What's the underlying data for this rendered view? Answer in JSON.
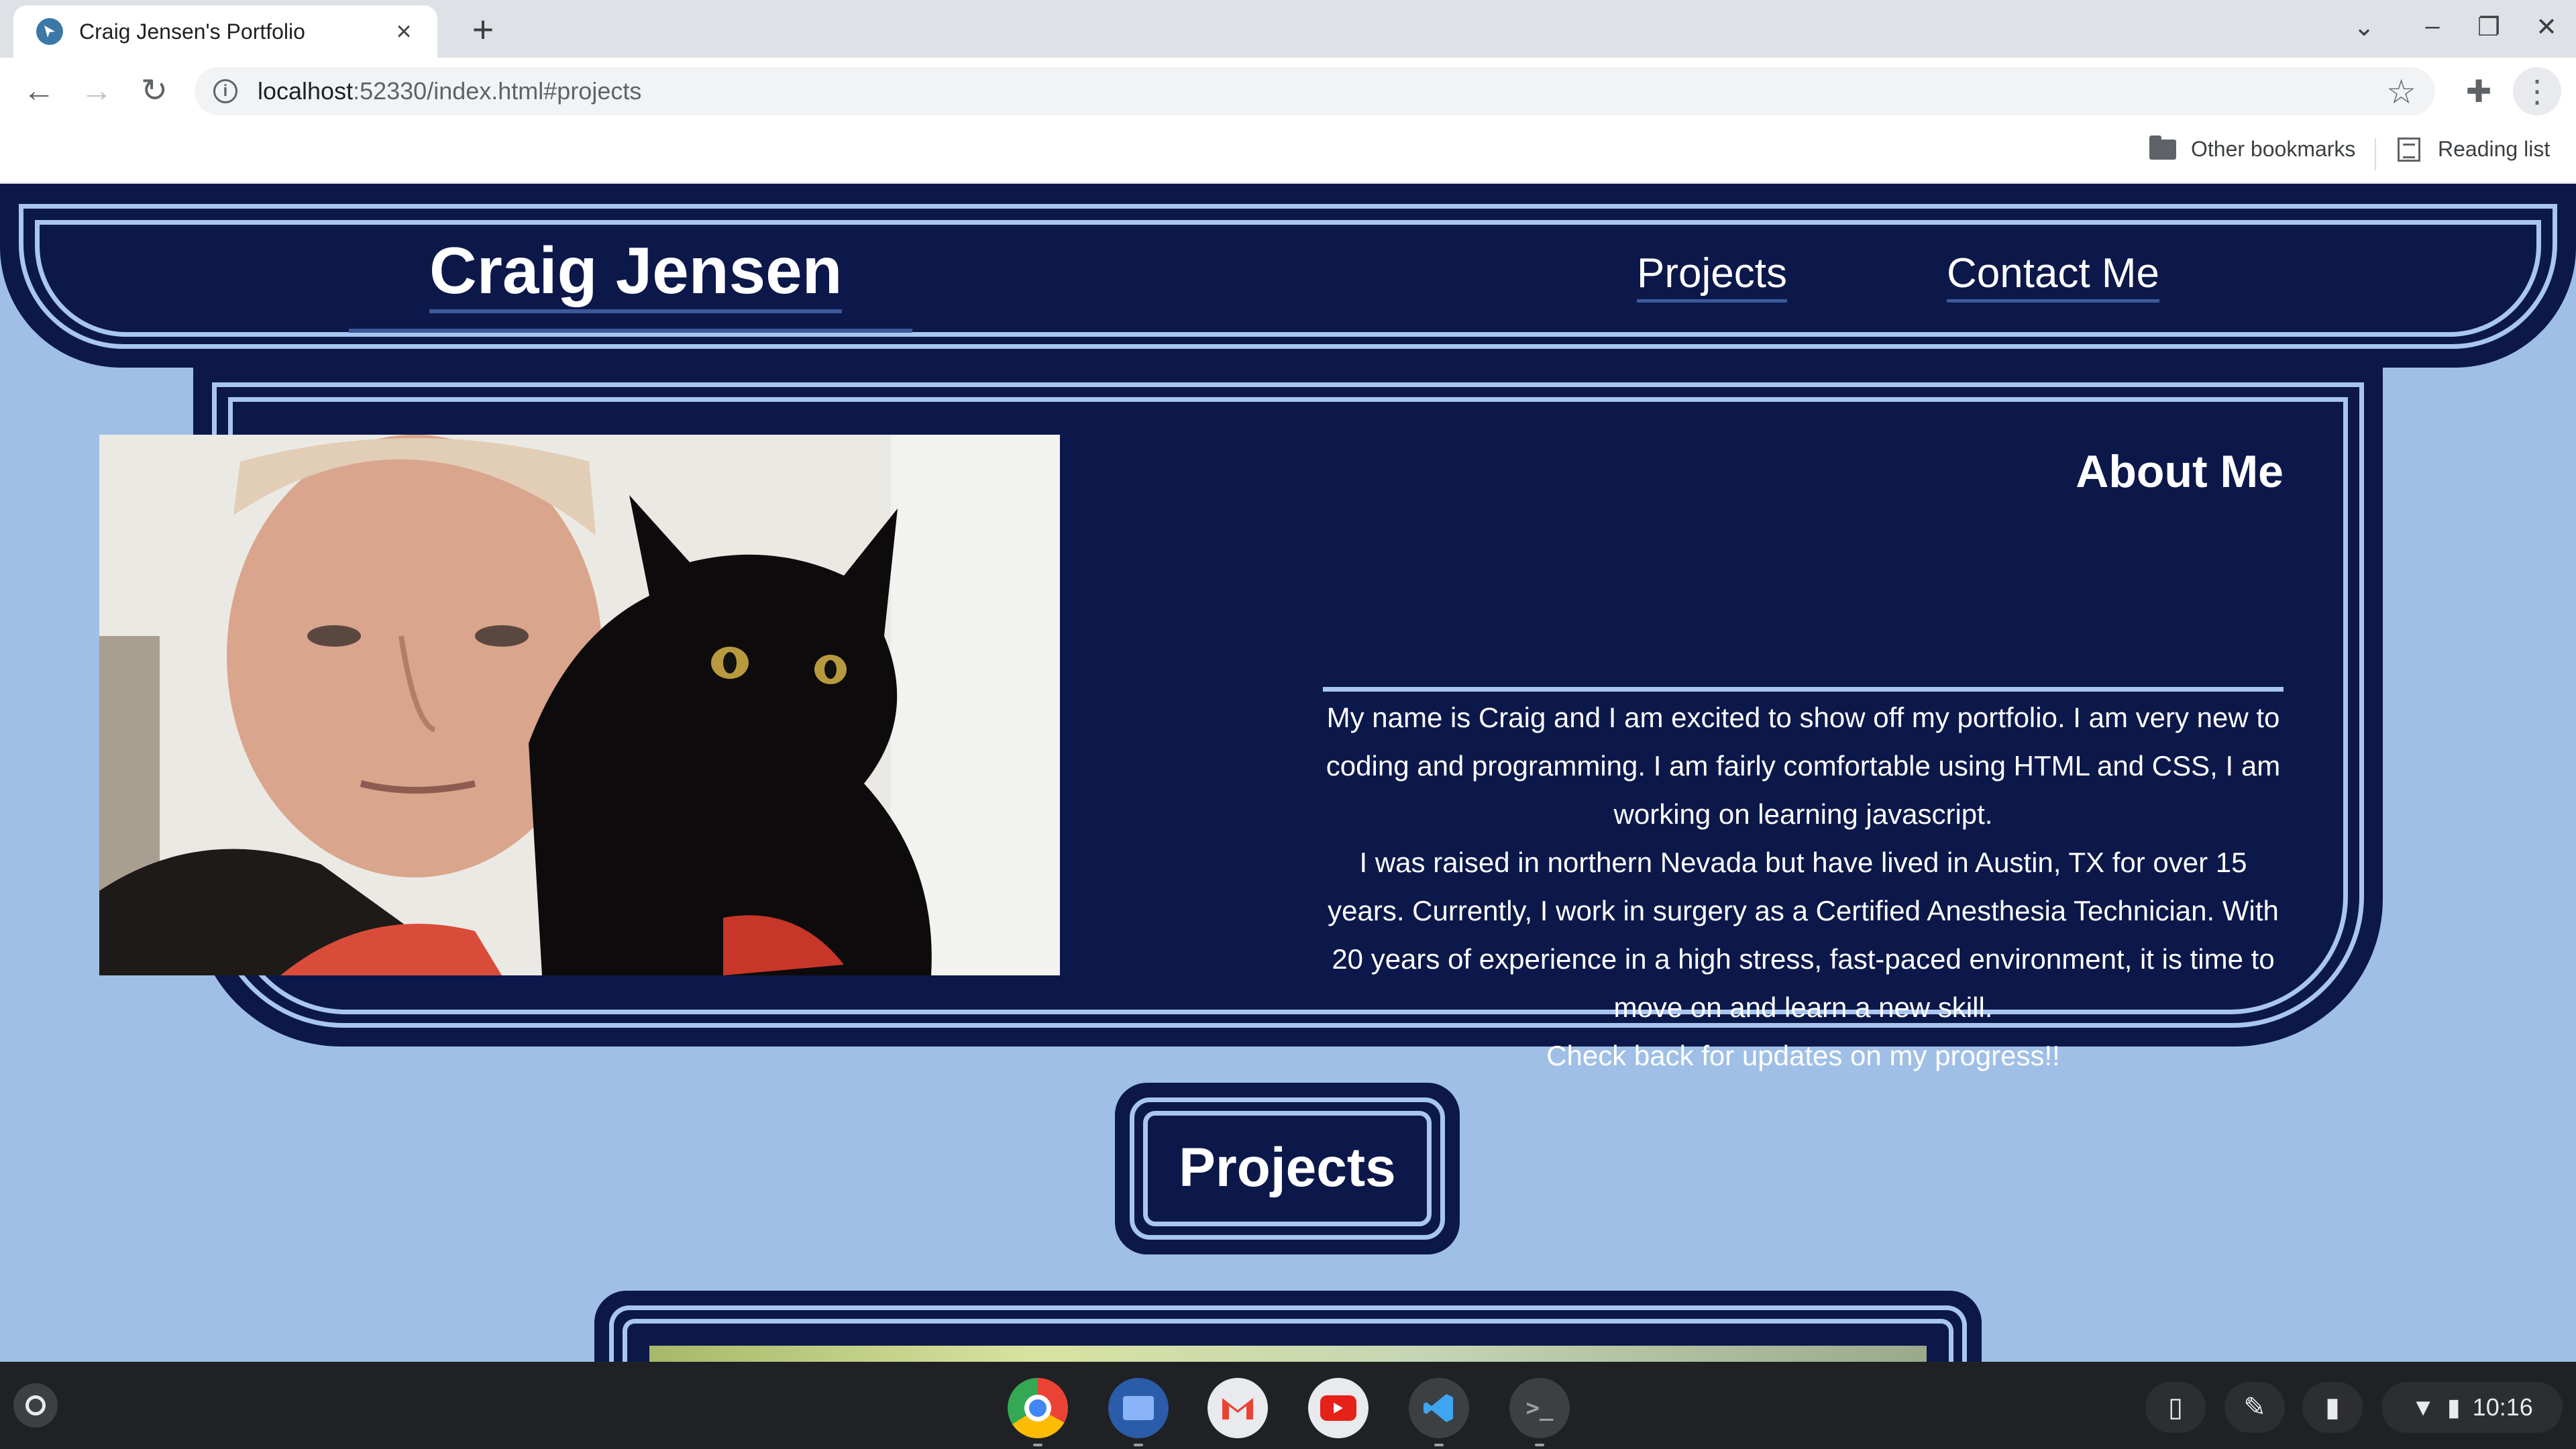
{
  "browser": {
    "tab_title": "Craig Jensen's Portfolio",
    "url_host": "localhost",
    "url_rest": ":52330/index.html#projects",
    "bookmarks": [
      "Other bookmarks",
      "Reading list"
    ]
  },
  "header": {
    "name": "Craig Jensen",
    "nav": [
      "Projects",
      "Contact Me"
    ]
  },
  "about": {
    "title": "About Me",
    "paragraphs": [
      "My name is Craig and I am excited to show off my portfolio. I am very new to coding and programming. I am fairly comfortable using HTML and CSS, I am working on learning javascript.",
      "I was raised in northern Nevada but have lived in Austin, TX for over 15 years. Currently, I work in surgery as a Certified Anesthesia Technician. With 20 years of experience in a high stress, fast-paced environment, it is time to move on and learn a new skill.",
      "Check back for updates on my progress!!"
    ]
  },
  "projects": {
    "title": "Projects"
  },
  "shelf": {
    "apps": [
      "chrome-app",
      "files-app",
      "gmail-app",
      "youtube-app",
      "vscode-app",
      "terminal-app"
    ],
    "terminal_glyph": ">_",
    "time": "10:16"
  },
  "colors": {
    "navy": "#0c184a",
    "light_blue": "#9fbfe6",
    "accent_ring": "#a8c6f0"
  }
}
